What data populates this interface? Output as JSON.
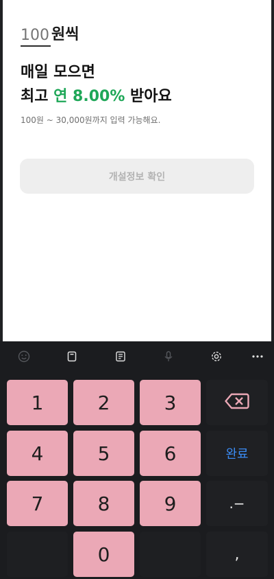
{
  "amount": {
    "placeholder": "100",
    "unit": "원씩"
  },
  "headline": {
    "line1": "매일 모으면",
    "line2_prefix": "최고 ",
    "rate": "연 8.00%",
    "line2_suffix": " 받아요"
  },
  "range_hint": "100원 ~ 30,000원까지 입력 가능해요.",
  "confirm_button": "개설정보 확인",
  "keyboard": {
    "toolbar": [
      "emoji-icon",
      "clipboard-icon",
      "keyboard-mode-icon",
      "mic-icon",
      "settings-icon",
      "more-icon"
    ],
    "keys": [
      "1",
      "2",
      "3",
      "4",
      "5",
      "6",
      "7",
      "8",
      "9",
      "0"
    ],
    "done_label": "완료",
    "dot_dash_label": ".−",
    "comma_label": ","
  },
  "colors": {
    "accent_green": "#1fa758",
    "key_pink": "#eba8b6",
    "done_blue": "#3b8cf5"
  }
}
